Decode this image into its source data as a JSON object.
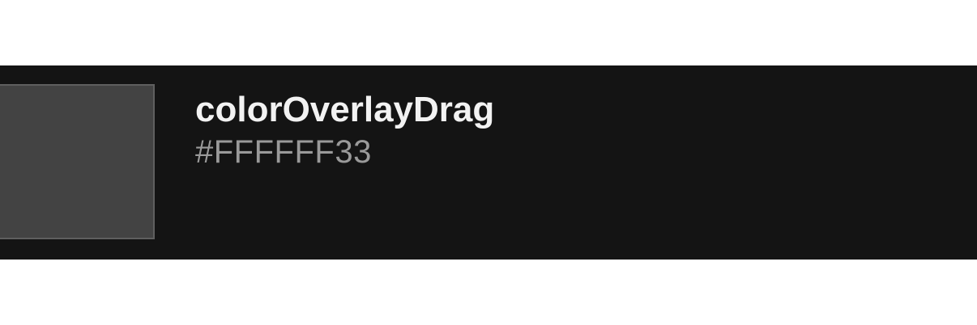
{
  "token": {
    "name": "colorOverlayDrag",
    "value": "#FFFFFF33",
    "swatch_display_color": "#434343",
    "band_background": "#141414"
  }
}
